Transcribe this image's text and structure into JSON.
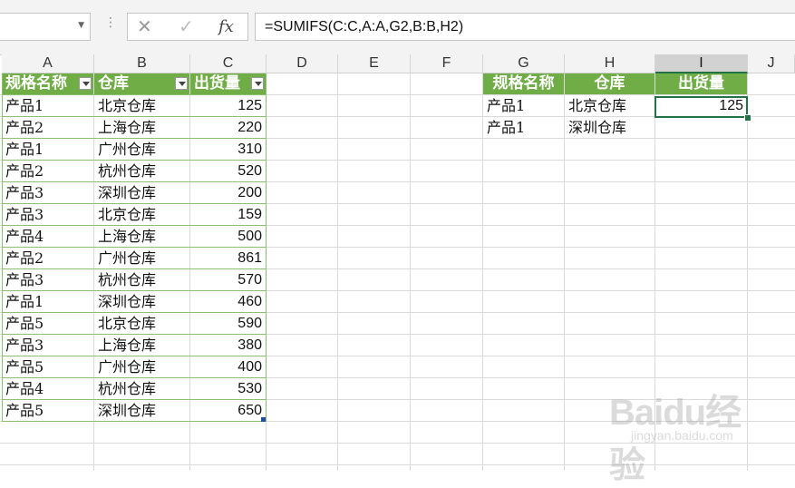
{
  "formula_bar": {
    "name_box_value": "",
    "cancel_icon": "✕",
    "enter_icon": "✓",
    "fx_label": "fx",
    "formula": "=SUMIFS(C:C,A:A,G2,B:B,H2)"
  },
  "columns": [
    "A",
    "B",
    "C",
    "D",
    "E",
    "F",
    "G",
    "H",
    "I",
    "J"
  ],
  "selected_column": "I",
  "table1": {
    "headers": [
      "规格名称",
      "仓库",
      "出货量"
    ],
    "rows": [
      [
        "产品1",
        "北京仓库",
        "125"
      ],
      [
        "产品2",
        "上海仓库",
        "220"
      ],
      [
        "产品1",
        "广州仓库",
        "310"
      ],
      [
        "产品2",
        "杭州仓库",
        "520"
      ],
      [
        "产品3",
        "深圳仓库",
        "200"
      ],
      [
        "产品3",
        "北京仓库",
        "159"
      ],
      [
        "产品4",
        "上海仓库",
        "500"
      ],
      [
        "产品2",
        "广州仓库",
        "861"
      ],
      [
        "产品3",
        "杭州仓库",
        "570"
      ],
      [
        "产品1",
        "深圳仓库",
        "460"
      ],
      [
        "产品5",
        "北京仓库",
        "590"
      ],
      [
        "产品3",
        "上海仓库",
        "380"
      ],
      [
        "产品5",
        "广州仓库",
        "400"
      ],
      [
        "产品4",
        "杭州仓库",
        "530"
      ],
      [
        "产品5",
        "深圳仓库",
        "650"
      ]
    ]
  },
  "table2": {
    "headers": [
      "规格名称",
      "仓库",
      "出货量"
    ],
    "rows": [
      [
        "产品1",
        "北京仓库",
        "125"
      ],
      [
        "产品1",
        "深圳仓库",
        ""
      ]
    ]
  },
  "watermark": {
    "main": "Baidu经验",
    "sub": "jingyan.baidu.com"
  },
  "colors": {
    "header_green": "#70ad47",
    "selection_green": "#217346"
  }
}
